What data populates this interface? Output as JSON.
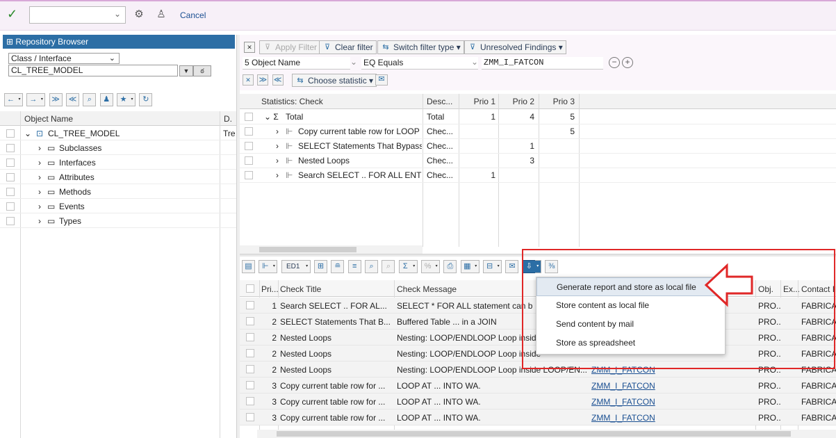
{
  "toolbar": {
    "combo_value": "",
    "cancel_label": "Cancel"
  },
  "repository": {
    "title": "Repository Browser",
    "object_type": "Class / Interface",
    "object_name": "CL_TREE_MODEL",
    "col_object_name": "Object Name",
    "col_d": "D.",
    "tree": [
      {
        "label": "CL_TREE_MODEL",
        "d": "Tre"
      },
      {
        "label": "Subclasses"
      },
      {
        "label": "Interfaces"
      },
      {
        "label": "Attributes"
      },
      {
        "label": "Methods"
      },
      {
        "label": "Events"
      },
      {
        "label": "Types"
      }
    ]
  },
  "filterbar": {
    "apply_filter": "Apply Filter",
    "clear_filter": "Clear filter",
    "switch_filter_type": "Switch filter type",
    "unresolved_findings": "Unresolved Findings",
    "field_name": "5 Object Name",
    "operator": "EQ Equals",
    "value": "ZMM_I_FATCON"
  },
  "stats": {
    "choose_statistic": "Choose statistic",
    "headers": {
      "check": "Statistics: Check",
      "desc": "Desc...",
      "p1": "Prio 1",
      "p2": "Prio 2",
      "p3": "Prio 3"
    },
    "rows": [
      {
        "check": "Total",
        "desc": "Total",
        "p1": "1",
        "p2": "4",
        "p3": "5"
      },
      {
        "check": "Copy current table row for LOOP ...",
        "desc": "Chec...",
        "p1": "",
        "p2": "",
        "p3": "5"
      },
      {
        "check": "SELECT Statements That Bypass t",
        "desc": "Chec...",
        "p1": "",
        "p2": "1",
        "p3": ""
      },
      {
        "check": "Nested Loops",
        "desc": "Chec...",
        "p1": "",
        "p2": "3",
        "p3": ""
      },
      {
        "check": "Search SELECT .. FOR ALL ENTRI",
        "desc": "Chec...",
        "p1": "1",
        "p2": "",
        "p3": ""
      }
    ]
  },
  "findings": {
    "layout_label": "ED1",
    "headers": {
      "pri": "Pri...",
      "title": "Check Title",
      "message": "Check Message",
      "obj": "Obj.",
      "ex": "Ex...",
      "contact": "Contact I"
    },
    "rows": [
      {
        "pri": "1",
        "title": "Search SELECT .. FOR AL...",
        "message": "SELECT * FOR ALL statement can b",
        "object": "",
        "obj": "PRO...",
        "contact": "FABRICA"
      },
      {
        "pri": "2",
        "title": "SELECT Statements That B...",
        "message": "Buffered Table ... in a JOIN",
        "object": "",
        "obj": "PRO...",
        "contact": "FABRICA"
      },
      {
        "pri": "2",
        "title": "Nested Loops",
        "message": "Nesting: LOOP/ENDLOOP Loop inside",
        "object": "",
        "obj": "PRO...",
        "contact": "FABRICA"
      },
      {
        "pri": "2",
        "title": "Nested Loops",
        "message": "Nesting: LOOP/ENDLOOP Loop inside",
        "object": "",
        "obj": "PRO...",
        "contact": "FABRICA"
      },
      {
        "pri": "2",
        "title": "Nested Loops",
        "message": "Nesting: LOOP/ENDLOOP Loop inside LOOP/EN...",
        "object": "ZMM_I_FATCON",
        "obj": "PRO...",
        "contact": "FABRICA"
      },
      {
        "pri": "3",
        "title": "Copy current table row for ...",
        "message": "LOOP AT ... INTO WA.",
        "object": "ZMM_I_FATCON",
        "obj": "PRO...",
        "contact": "FABRICA"
      },
      {
        "pri": "3",
        "title": "Copy current table row for ...",
        "message": "LOOP AT ... INTO WA.",
        "object": "ZMM_I_FATCON",
        "obj": "PRO...",
        "contact": "FABRICA"
      },
      {
        "pri": "3",
        "title": "Copy current table row for ...",
        "message": "LOOP AT ... INTO WA.",
        "object": "ZMM_I_FATCON",
        "obj": "PRO...",
        "contact": "FABRICA"
      }
    ]
  },
  "export_menu": {
    "items": [
      "Generate report and store as local file",
      "Store content as local file",
      "Send content by mail",
      "Store as spreadsheet"
    ]
  },
  "colors": {
    "highlight_box": "#e02727",
    "title_bar": "#2c6ea5"
  }
}
